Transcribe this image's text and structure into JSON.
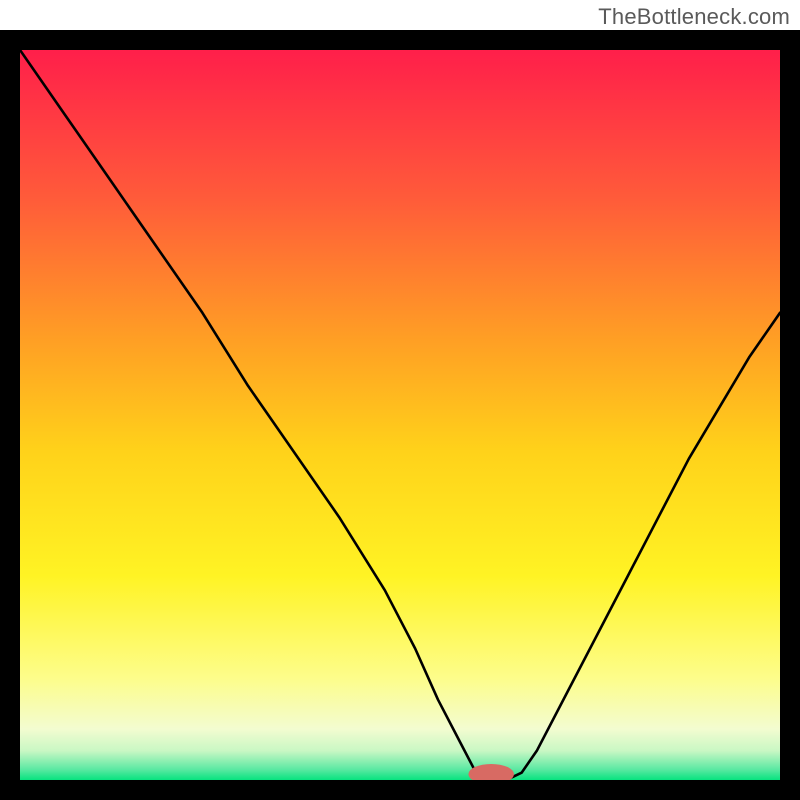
{
  "watermark": "TheBottleneck.com",
  "chart_data": {
    "type": "line",
    "title": "",
    "xlabel": "",
    "ylabel": "",
    "xlim": [
      0,
      100
    ],
    "ylim": [
      0,
      100
    ],
    "grid": false,
    "legend": false,
    "background": {
      "type": "vertical-gradient",
      "stops": [
        {
          "offset": 0.0,
          "color": "#ff1f4a"
        },
        {
          "offset": 0.2,
          "color": "#ff5a3a"
        },
        {
          "offset": 0.4,
          "color": "#ffa024"
        },
        {
          "offset": 0.55,
          "color": "#ffd21a"
        },
        {
          "offset": 0.72,
          "color": "#fff324"
        },
        {
          "offset": 0.86,
          "color": "#fdfd8a"
        },
        {
          "offset": 0.93,
          "color": "#f3fcd0"
        },
        {
          "offset": 0.96,
          "color": "#c9f7c4"
        },
        {
          "offset": 0.985,
          "color": "#5de9a3"
        },
        {
          "offset": 1.0,
          "color": "#07e37f"
        }
      ]
    },
    "curve_style": {
      "stroke": "#000000",
      "width": 2.6
    },
    "x": [
      0,
      6,
      12,
      18,
      24,
      30,
      36,
      42,
      48,
      52,
      55,
      58,
      60,
      62,
      64,
      66,
      68,
      72,
      76,
      80,
      84,
      88,
      92,
      96,
      100
    ],
    "y": [
      100,
      91,
      82,
      73,
      64,
      54,
      45,
      36,
      26,
      18,
      11,
      5,
      1,
      0,
      0,
      1,
      4,
      12,
      20,
      28,
      36,
      44,
      51,
      58,
      64
    ],
    "marker": {
      "x": 62,
      "y": 0,
      "rx": 3,
      "ry": 1.4,
      "color": "#d86a63"
    }
  }
}
